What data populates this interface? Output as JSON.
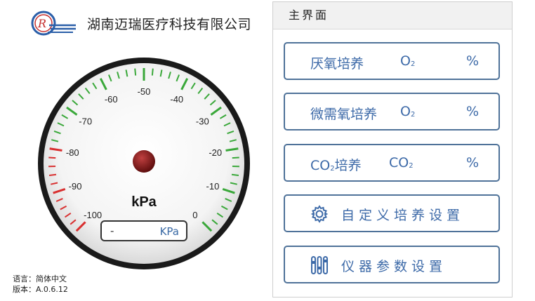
{
  "header": {
    "company_name": "湖南迈瑞医疗科技有限公司",
    "logo_icon": "company-logo-icon"
  },
  "gauge": {
    "unit": "kPa",
    "min": -100,
    "max": 0,
    "ticks": [
      "-100",
      "-90",
      "-80",
      "-70",
      "-60",
      "-50",
      "-40",
      "-30",
      "-20",
      "-10",
      "0"
    ],
    "readout_value": "-",
    "readout_unit": "KPa",
    "colors": {
      "safe": "#3aa83a",
      "danger": "#d93030",
      "needle_hub": "#8a1a1a"
    }
  },
  "info": {
    "language": "语言：简体中文",
    "version": "版本：A.0.6.12"
  },
  "panel": {
    "title": "主界面",
    "buttons": [
      {
        "name": "厌氧培养",
        "gas_main": "O",
        "gas_sub": "2",
        "percent": "%"
      },
      {
        "name": "微需氧培养",
        "gas_main": "O",
        "gas_sub": "2",
        "percent": "%"
      },
      {
        "name_main": "CO",
        "name_sub": "2",
        "name_rest": "培养",
        "gas_main": "CO",
        "gas_sub": "2",
        "percent": "%"
      }
    ],
    "custom_setting": {
      "label": "自定义培养设置",
      "icon": "gear-icon"
    },
    "instrument_setting": {
      "label": "仪器参数设置",
      "icon": "sliders-icon"
    }
  }
}
